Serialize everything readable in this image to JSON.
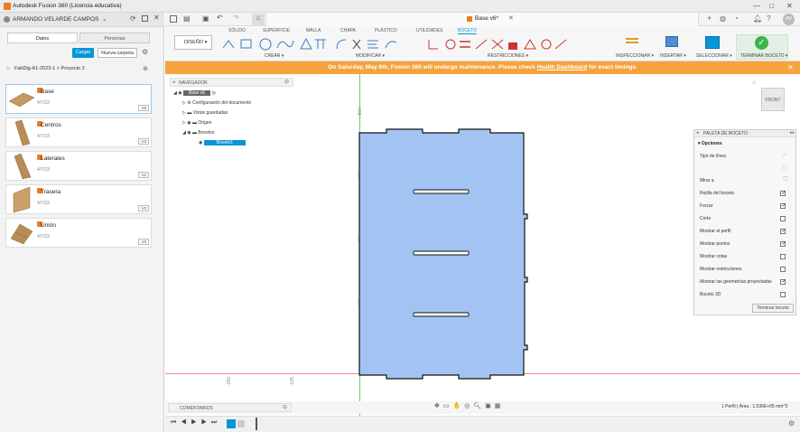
{
  "window": {
    "title": "Autodesk Fusion 360 (Licencia educativa)",
    "minimize": "—",
    "maximize": "□",
    "close": "✕"
  },
  "user": {
    "name": "ARMANDO VELARDE CAMPOS",
    "initials": "AV"
  },
  "data_panel": {
    "tabs": [
      "Datos",
      "Personas"
    ],
    "upload_label": "Cargar",
    "new_folder_label": "Nueva carpeta",
    "breadcrumb": [
      "FabDig-A1-2023-1",
      "Proyecto 2"
    ],
    "items": [
      {
        "name": "Base",
        "date": "4/7/23",
        "version": "V6"
      },
      {
        "name": "Centros",
        "date": "4/7/23",
        "version": "V3"
      },
      {
        "name": "Laterales",
        "date": "4/7/23",
        "version": "V2"
      },
      {
        "name": "Trasera",
        "date": "4/7/23",
        "version": "V3"
      },
      {
        "name": "Unión",
        "date": "4/7/23",
        "version": "V3"
      }
    ]
  },
  "doc_tab": {
    "title": "Base v6*"
  },
  "ribbon": {
    "tabs": [
      "SÓLIDO",
      "SUPERFICIE",
      "MALLA",
      "CHAPA",
      "PLÁSTICO",
      "UTILIDADES",
      "BOCETO"
    ],
    "active_tab": "BOCETO",
    "workspace": "DISEÑO",
    "groups": [
      "CREAR",
      "MODIFICAR",
      "RESTRICCIONES",
      "INSPECCIONAR",
      "INSERTAR",
      "SELECCIONAR",
      "TERMINAR BOCETO"
    ]
  },
  "banner": {
    "text_before": "On Saturday, May 6th, Fusion 360 will undergo maintenance. Please check ",
    "link": "Health Dashboard",
    "text_after": " for exact timings."
  },
  "navigator": {
    "title": "NAVEGADOR",
    "root": "Base v6",
    "nodes": [
      "Configuración del documento",
      "Vistas guardadas",
      "Origen",
      "Bocetos",
      "Boceto1"
    ]
  },
  "viewcube": {
    "face": "FRONT"
  },
  "rulers": {
    "v_ticks": [
      "500",
      "375",
      "250",
      "125"
    ],
    "h_ticks": [
      "-250",
      "-125"
    ]
  },
  "palette": {
    "title": "PALETA DE BOCETO",
    "section": "Opciones",
    "rows": [
      {
        "label": "Tipo de línea",
        "checked": null
      },
      {
        "label": "Mirar a",
        "checked": null
      },
      {
        "label": "Rejilla del boceto",
        "checked": true
      },
      {
        "label": "Forzar",
        "checked": true
      },
      {
        "label": "Corte",
        "checked": false
      },
      {
        "label": "Mostrar el perfil",
        "checked": true
      },
      {
        "label": "Mostrar puntos",
        "checked": true
      },
      {
        "label": "Mostrar cotas",
        "checked": false
      },
      {
        "label": "Mostrar restricciones",
        "checked": false
      },
      {
        "label": "Mostrar las geometrías proyectadas",
        "checked": true
      },
      {
        "label": "Boceto 3D",
        "checked": false
      }
    ],
    "finish_label": "Terminar boceto"
  },
  "comments": {
    "label": "COMENTARIOS"
  },
  "status": {
    "text": "1 Perfil | Área : 1.536E+05 mm^2"
  },
  "colors": {
    "accent": "#0696d7",
    "warning": "#f5a33a",
    "sketch_fill": "#a3c4f3",
    "finish_green": "#3bb44a"
  }
}
